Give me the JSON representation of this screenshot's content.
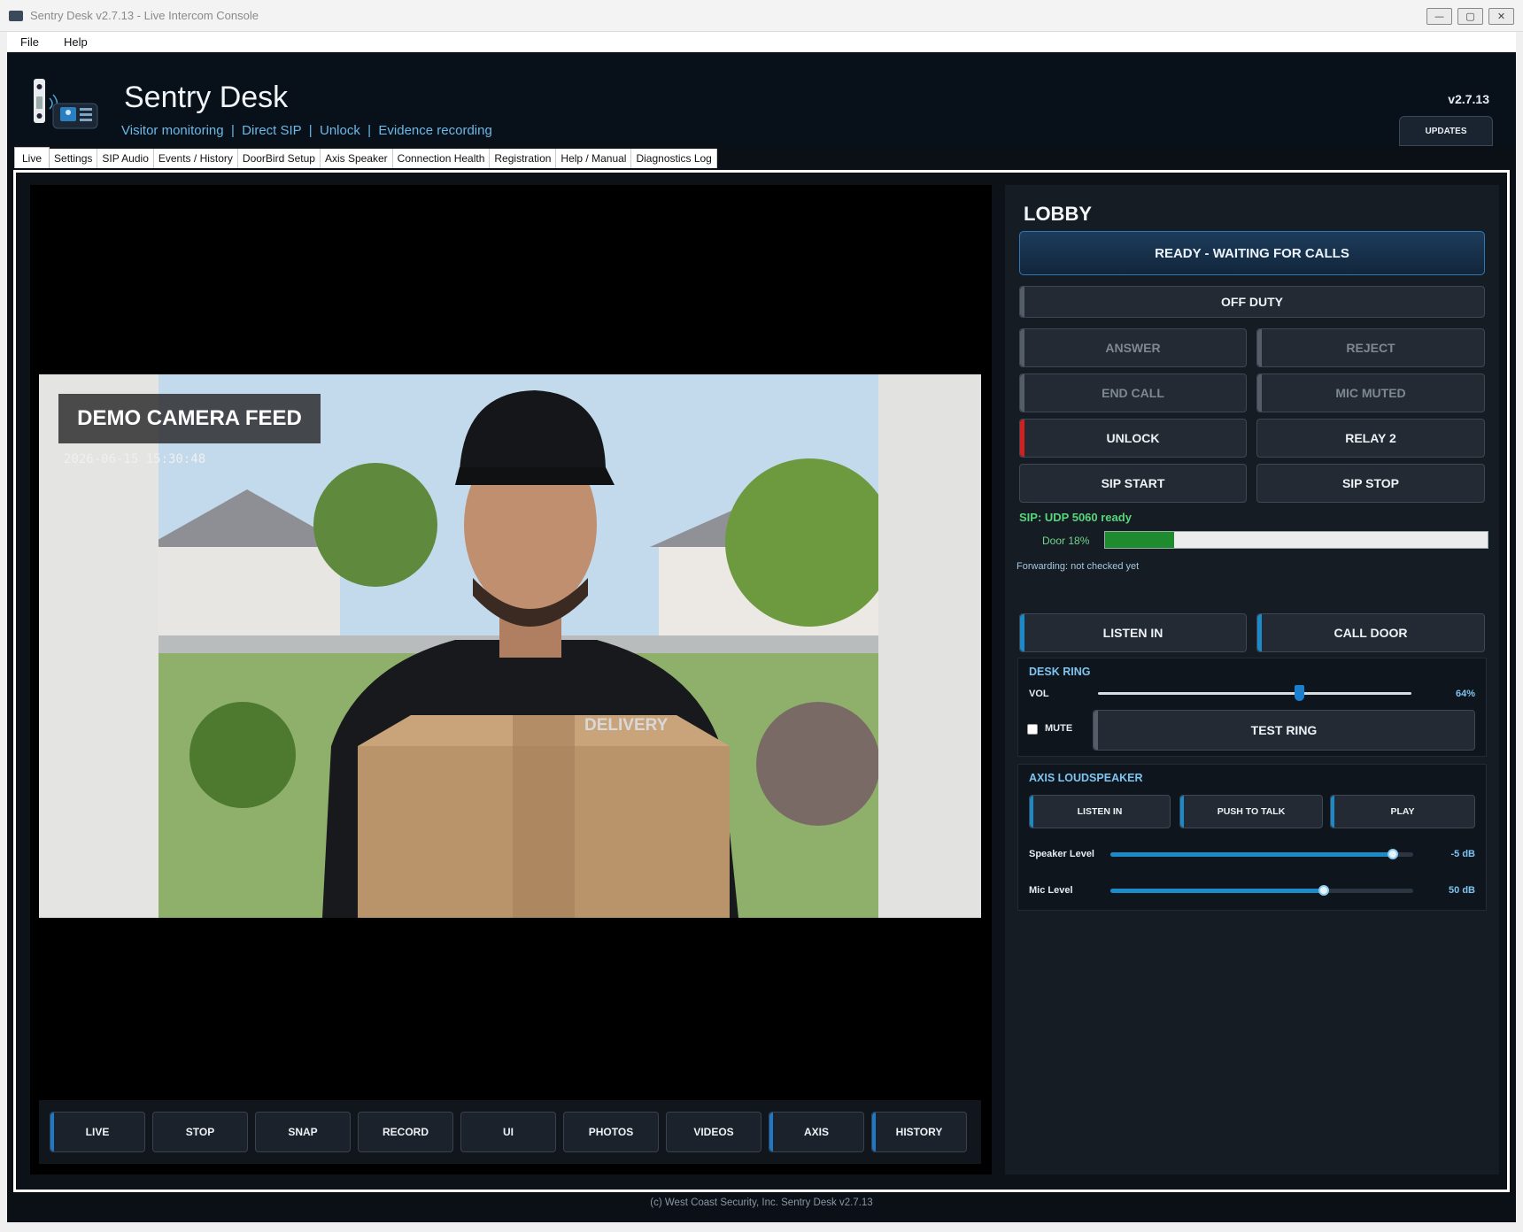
{
  "window": {
    "title": "Sentry Desk v2.7.13 - Live Intercom Console",
    "controls": [
      "—",
      "▢",
      "✕"
    ]
  },
  "menu": [
    "File",
    "Help"
  ],
  "header": {
    "title": "Sentry Desk",
    "subtitle": "Visitor monitoring  |  Direct SIP  |  Unlock  |  Evidence recording",
    "version": "v2.7.13",
    "updates_label": "UPDATES"
  },
  "tabs": [
    "Live",
    "Settings",
    "SIP Audio",
    "Events / History",
    "DoorBird Setup",
    "Axis Speaker",
    "Connection Health",
    "Registration",
    "Help / Manual",
    "Diagnostics Log"
  ],
  "camera": {
    "overlay_label": "DEMO CAMERA FEED",
    "timestamp": "2026-06-15 15:30:48",
    "shirt_text": "DELIVERY"
  },
  "toolbar": [
    "LIVE",
    "STOP",
    "SNAP",
    "RECORD",
    "UI",
    "PHOTOS",
    "VIDEOS",
    "AXIS",
    "HISTORY"
  ],
  "side": {
    "door_name": "LOBBY",
    "status": "READY - WAITING FOR CALLS",
    "off_duty": "OFF DUTY",
    "answer": "ANSWER",
    "reject": "REJECT",
    "end_call": "END CALL",
    "mic_muted": "MIC MUTED",
    "unlock": "UNLOCK",
    "relay2": "RELAY 2",
    "sip_start": "SIP START",
    "sip_stop": "SIP STOP",
    "sip_status": "SIP: UDP 5060 ready",
    "door_label": "Door 18%",
    "door_progress": 0.18,
    "forwarding": "Forwarding: not checked yet",
    "listen_in": "LISTEN IN",
    "call_door": "CALL DOOR",
    "desk_ring": {
      "title": "DESK RING",
      "vol_label": "VOL",
      "vol_value": "64%",
      "vol_level": 0.64,
      "mute_label": "MUTE",
      "test_ring": "TEST RING"
    },
    "axis": {
      "title": "AXIS LOUDSPEAKER",
      "listen_in": "LISTEN IN",
      "push_to_talk": "PUSH TO TALK",
      "play": "PLAY",
      "speaker_label": "Speaker Level",
      "speaker_value": "-5 dB",
      "speaker_level": 0.94,
      "mic_label": "Mic Level",
      "mic_value": "50 dB",
      "mic_level": 0.71
    }
  },
  "footer": "(c) West Coast Security, Inc.  Sentry Desk v2.7.13"
}
